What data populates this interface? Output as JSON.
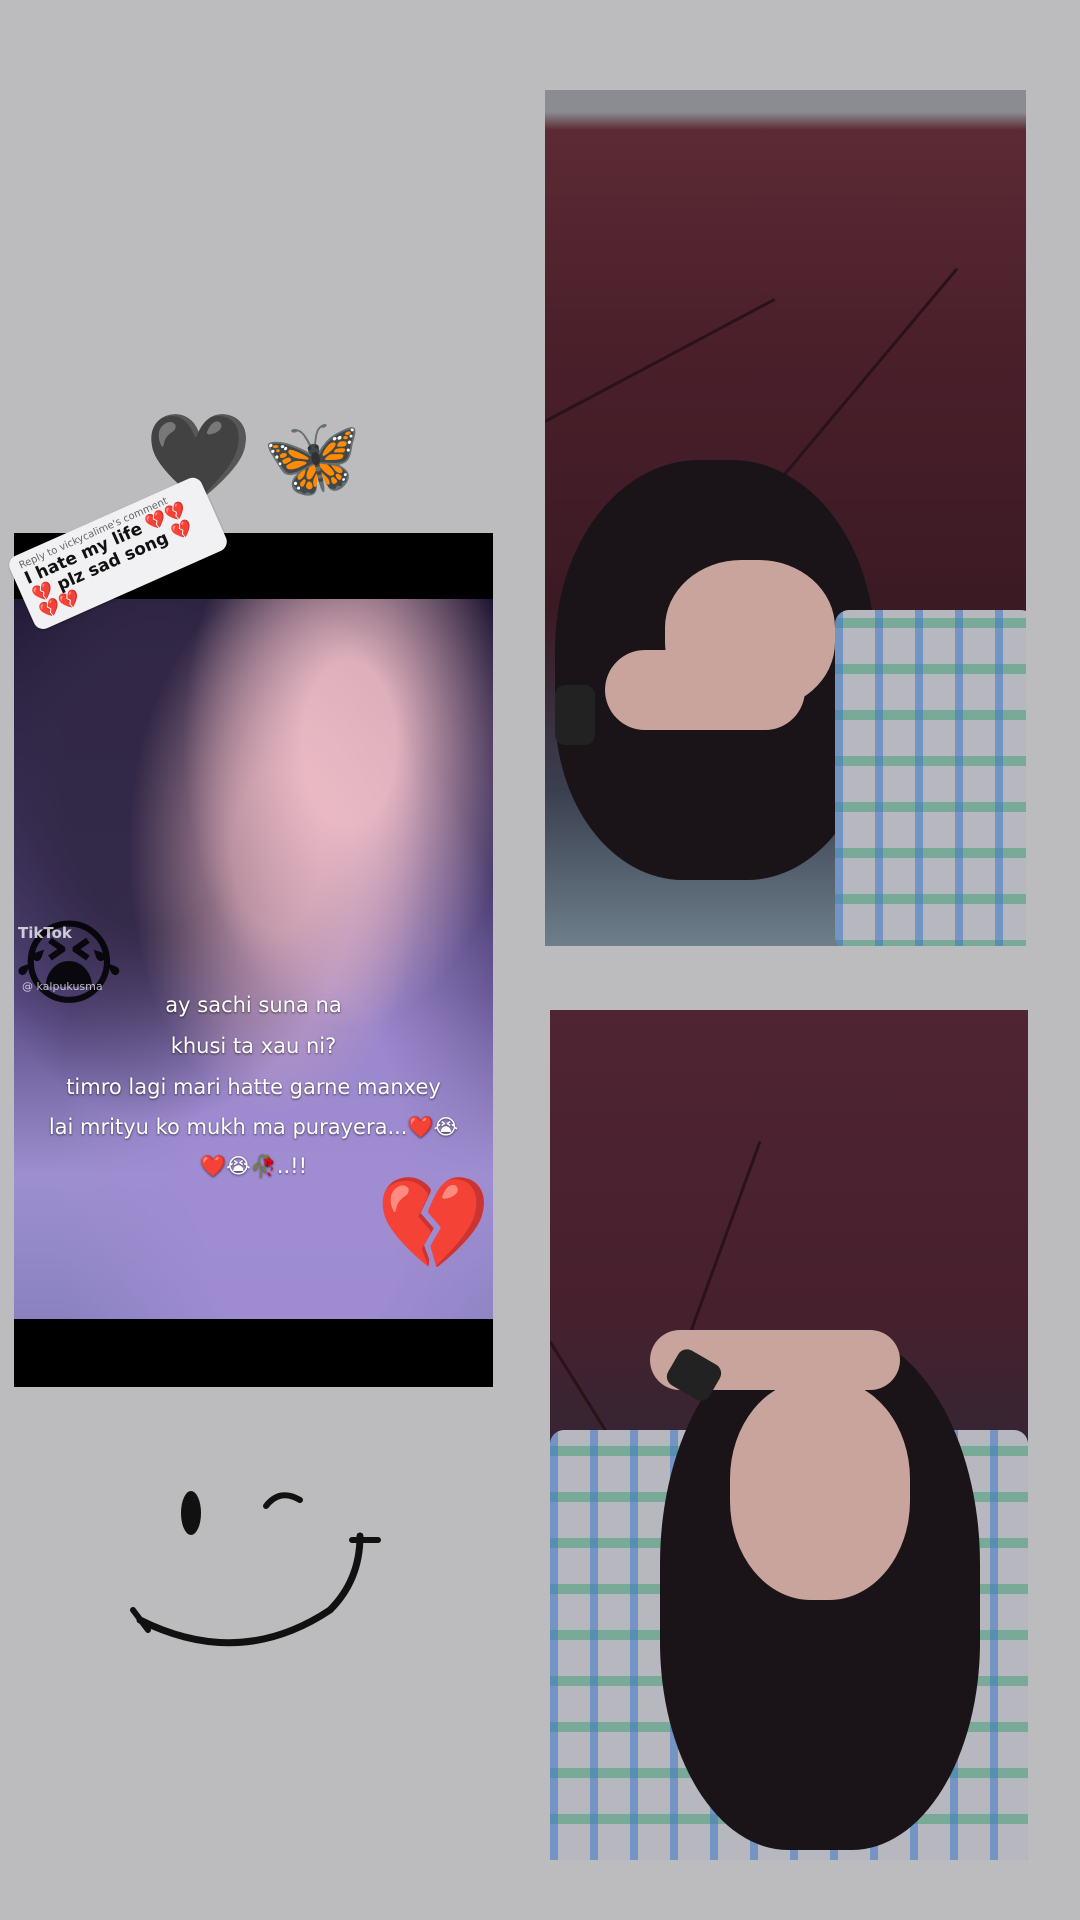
{
  "emojis": {
    "black_heart": "🖤",
    "butterfly": "🦋",
    "crying": "😭",
    "broken_heart": "💔"
  },
  "video": {
    "reply_to": "Reply to vickycalime's comment",
    "reply_text": "I hate my life 💔💔💔 plz sad song 💔💔💔",
    "tiktok_logo": "TikTok",
    "tiktok_user": "@ kalpukusma",
    "captions": [
      "ay sachi suna na",
      "khusi ta xau ni?",
      "timro lagi mari hatte garne manxey",
      "lai mrityu ko mukh ma purayera...❤️😭",
      "❤️😭🥀..!!"
    ]
  },
  "colors": {
    "background": "#bcbcbe",
    "umbrella": "#4a1f2a",
    "video_bg": "#000000"
  }
}
